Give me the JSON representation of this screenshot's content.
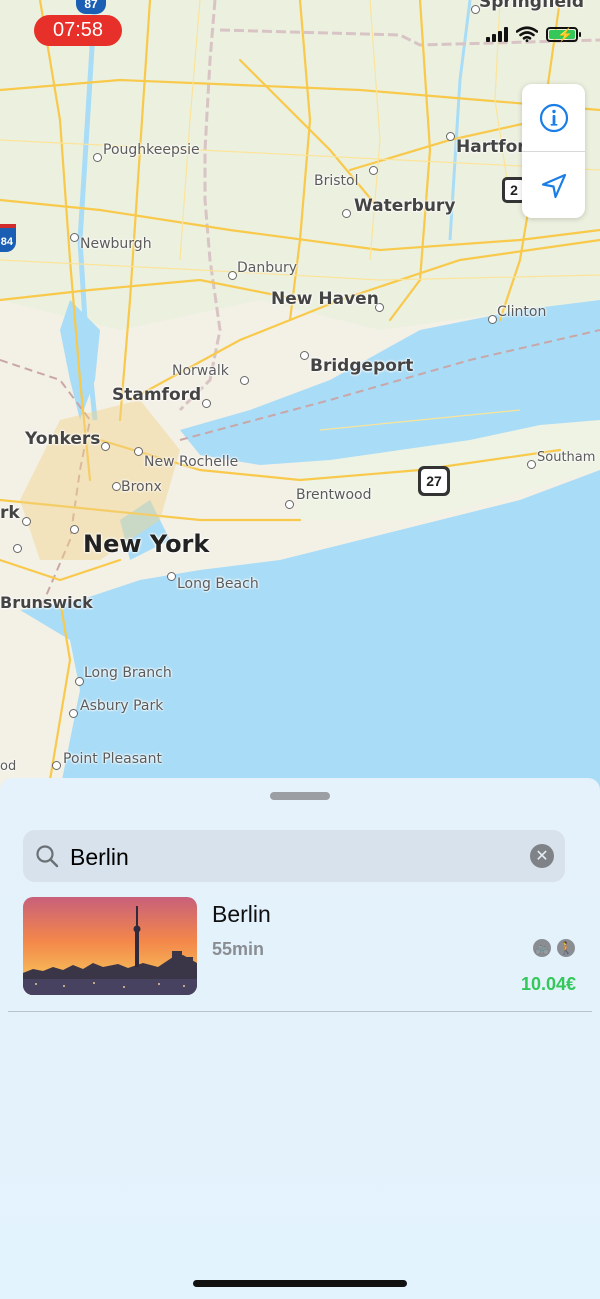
{
  "status_bar": {
    "time": "07:58"
  },
  "map": {
    "cities": [
      {
        "name": "Springfield",
        "type": "minor"
      },
      {
        "name": "Hartford",
        "type": "medium"
      },
      {
        "name": "Poughkeepsie",
        "type": "minor"
      },
      {
        "name": "Bristol",
        "type": "minor"
      },
      {
        "name": "Waterbury",
        "type": "medium"
      },
      {
        "name": "Newburgh",
        "type": "minor"
      },
      {
        "name": "Danbury",
        "type": "minor"
      },
      {
        "name": "New Haven",
        "type": "medium"
      },
      {
        "name": "Clinton",
        "type": "minor"
      },
      {
        "name": "Norwalk",
        "type": "minor"
      },
      {
        "name": "Bridgeport",
        "type": "medium"
      },
      {
        "name": "Stamford",
        "type": "medium"
      },
      {
        "name": "Yonkers",
        "type": "medium"
      },
      {
        "name": "New Rochelle",
        "type": "minor"
      },
      {
        "name": "Bronx",
        "type": "minor"
      },
      {
        "name": "Brentwood",
        "type": "minor"
      },
      {
        "name": "Southam",
        "type": "minor"
      },
      {
        "name": "New York",
        "type": "major"
      },
      {
        "name": "Long Beach",
        "type": "minor"
      },
      {
        "name": "Brunswick",
        "type": "medium"
      },
      {
        "name": "Long Branch",
        "type": "minor"
      },
      {
        "name": "Asbury Park",
        "type": "minor"
      },
      {
        "name": "Point Pleasant",
        "type": "minor"
      },
      {
        "name": "rk",
        "type": "medium"
      },
      {
        "name": "od",
        "type": "minor"
      }
    ],
    "route_shields": [
      "87",
      "84",
      "2",
      "27"
    ]
  },
  "controls": {
    "info_icon": "info-icon",
    "locate_icon": "location-arrow-icon"
  },
  "search": {
    "value": "Berlin",
    "placeholder": "Search"
  },
  "results": [
    {
      "title": "Berlin",
      "duration": "55min",
      "price": "10.04€",
      "icons": [
        "bike-icon",
        "walk-icon"
      ]
    }
  ],
  "colors": {
    "accent": "#1a7ee6",
    "price": "#34c759",
    "recording": "#e8302a",
    "water": "#a9dcf6"
  }
}
